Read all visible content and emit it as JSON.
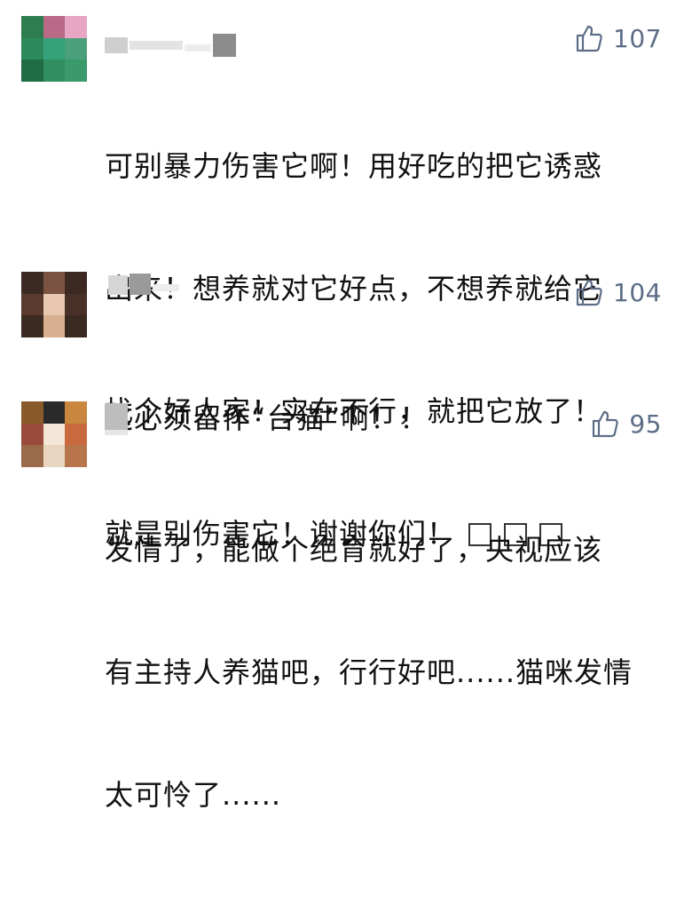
{
  "comments": [
    {
      "likes": "107",
      "text_lines": [
        "可别暴力伤害它啊！用好吃的把它诱惑",
        "出来！想养就对它好点，不想养就给它",
        "找个好人家！实在不行，就把它放了！",
        "就是别伤害它！谢谢你们！"
      ],
      "trailing_glyphs": 3,
      "avatar_colors": [
        "#2e7d4f",
        "#b86a86",
        "#e7a6c4",
        "#2c8a5a",
        "#35a178",
        "#49a07a",
        "#1f6b44",
        "#2f8f61",
        "#3a9a6c"
      ]
    },
    {
      "likes": "104",
      "text_lines": [
        "这必须留作“台猫”啊！！"
      ],
      "avatar_colors": [
        "#3a2a22",
        "#7a5342",
        "#3c2a22",
        "#5a3a2e",
        "#e8c8b0",
        "#4a3128",
        "#3b2a22",
        "#d9b08f",
        "#3a2a22"
      ]
    },
    {
      "likes": "95",
      "text_lines": [
        "发情了，能做个绝育就好了，央视应该",
        "有主持人养猫吧，行行好吧......猫咪发情",
        "太可怜了......"
      ],
      "avatar_colors": [
        "#8a5a2a",
        "#2a2a2a",
        "#c9863e",
        "#9a4a3a",
        "#f4e6d6",
        "#c86a3e",
        "#9a6a4a",
        "#e9d6c2",
        "#b8744a"
      ]
    }
  ]
}
